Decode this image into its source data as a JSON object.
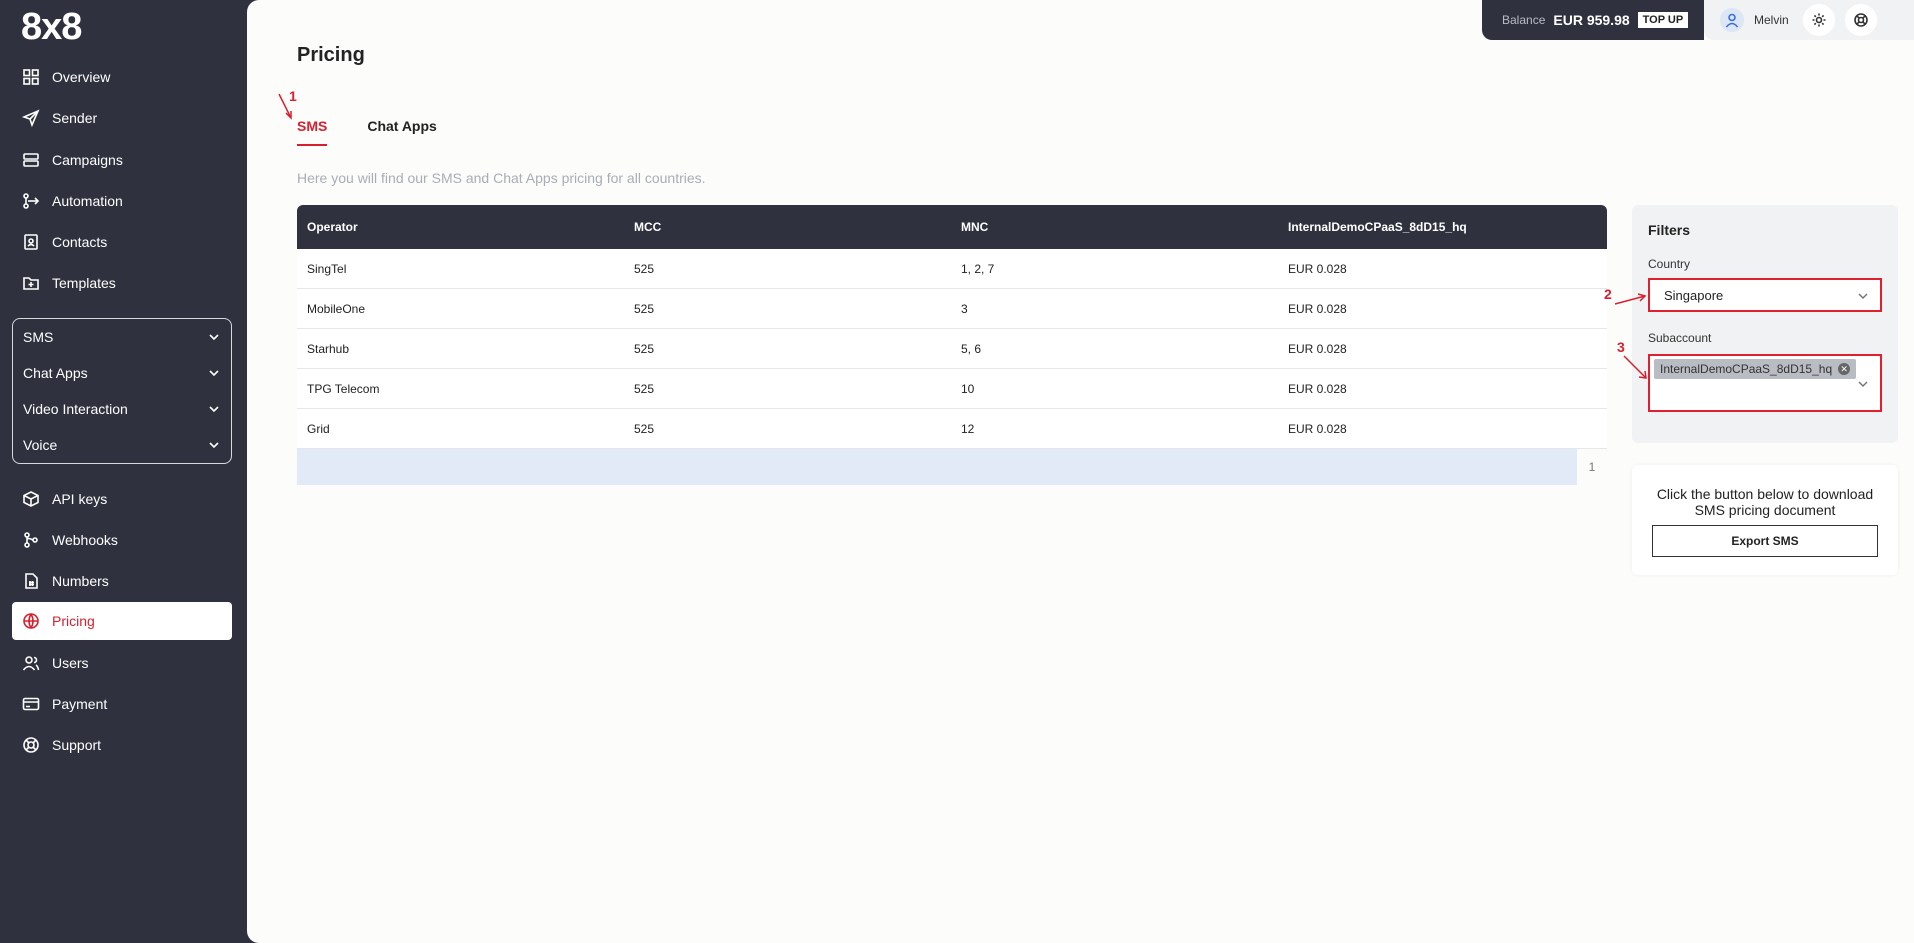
{
  "brand": {
    "logo_text": "8x8"
  },
  "sidebar": {
    "items_top": [
      {
        "label": "Overview",
        "icon": "grid-icon"
      },
      {
        "label": "Sender",
        "icon": "send-icon"
      },
      {
        "label": "Campaigns",
        "icon": "layers-icon"
      },
      {
        "label": "Automation",
        "icon": "flow-icon"
      },
      {
        "label": "Contacts",
        "icon": "contact-icon"
      },
      {
        "label": "Templates",
        "icon": "template-icon"
      }
    ],
    "groups": [
      {
        "label": "SMS"
      },
      {
        "label": "Chat Apps"
      },
      {
        "label": "Video Interaction"
      },
      {
        "label": "Voice"
      }
    ],
    "items_bottom": [
      {
        "label": "API keys",
        "icon": "cube-icon"
      },
      {
        "label": "Webhooks",
        "icon": "webhook-icon"
      },
      {
        "label": "Numbers",
        "icon": "hash-icon"
      },
      {
        "label": "Pricing",
        "icon": "globe-icon"
      },
      {
        "label": "Users",
        "icon": "users-icon"
      },
      {
        "label": "Payment",
        "icon": "card-icon"
      },
      {
        "label": "Support",
        "icon": "lifebuoy-icon"
      }
    ]
  },
  "header": {
    "balance_label": "Balance",
    "balance_value": "EUR 959.98",
    "topup_label": "TOP UP",
    "user_name": "Melvin"
  },
  "page": {
    "title": "Pricing",
    "tabs": [
      {
        "label": "SMS"
      },
      {
        "label": "Chat Apps"
      }
    ],
    "description": "Here you will find our SMS and Chat Apps pricing for all countries."
  },
  "table": {
    "columns": [
      "Operator",
      "MCC",
      "MNC",
      "InternalDemoCPaaS_8dD15_hq"
    ],
    "rows": [
      [
        "SingTel",
        "525",
        "1, 2, 7",
        "EUR 0.028"
      ],
      [
        "MobileOne",
        "525",
        "3",
        "EUR 0.028"
      ],
      [
        "Starhub",
        "525",
        "5, 6",
        "EUR 0.028"
      ],
      [
        "TPG Telecom",
        "525",
        "10",
        "EUR 0.028"
      ],
      [
        "Grid",
        "525",
        "12",
        "EUR 0.028"
      ]
    ],
    "page_number": "1"
  },
  "filters": {
    "title": "Filters",
    "country_label": "Country",
    "country_value": "Singapore",
    "subaccount_label": "Subaccount",
    "subaccount_chip": "InternalDemoCPaaS_8dD15_hq"
  },
  "export": {
    "text": "Click the button below to download SMS pricing document",
    "button_label": "Export SMS"
  },
  "annotations": [
    "1",
    "2",
    "3"
  ],
  "colors": {
    "accent": "#d6202f",
    "sidebar": "#2f323e"
  }
}
